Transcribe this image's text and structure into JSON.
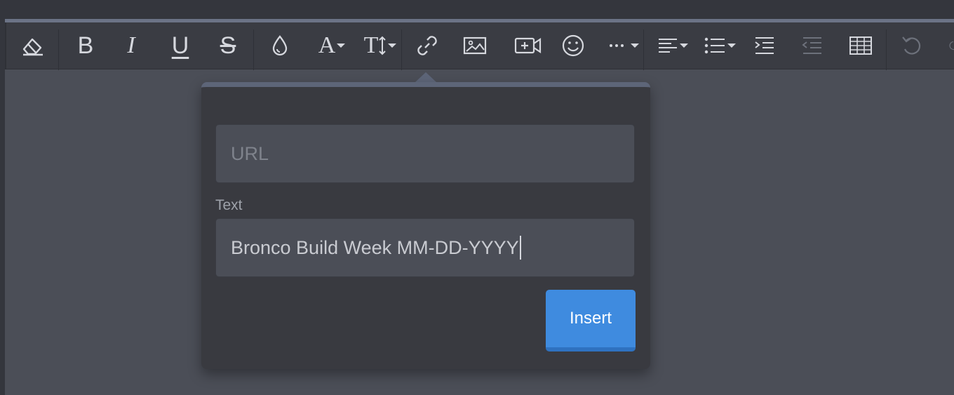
{
  "toolbar": {
    "buttons": [
      {
        "name": "eraser-icon"
      },
      {
        "name": "bold-icon"
      },
      {
        "name": "italic-icon"
      },
      {
        "name": "underline-icon"
      },
      {
        "name": "strikethrough-icon"
      },
      {
        "name": "color-drop-icon"
      },
      {
        "name": "font-family-icon"
      },
      {
        "name": "font-size-icon"
      },
      {
        "name": "link-icon"
      },
      {
        "name": "image-icon"
      },
      {
        "name": "video-icon"
      },
      {
        "name": "emoji-icon"
      },
      {
        "name": "more-icon"
      },
      {
        "name": "align-icon"
      },
      {
        "name": "list-icon"
      },
      {
        "name": "indent-icon"
      },
      {
        "name": "outdent-icon"
      },
      {
        "name": "table-icon"
      },
      {
        "name": "undo-icon"
      },
      {
        "name": "redo-icon"
      }
    ],
    "glyphs": {
      "bold": "B",
      "italic": "I",
      "underline": "U",
      "strike": "S",
      "font": "A",
      "size": "T"
    }
  },
  "link_popover": {
    "url_placeholder": "URL",
    "text_label": "Text",
    "text_value": "Bronco Build Week MM-DD-YYYY",
    "insert_label": "Insert"
  },
  "colors": {
    "accent": "#3f8bdf",
    "background": "#4b4e57",
    "toolbar": "#3a3c43"
  }
}
